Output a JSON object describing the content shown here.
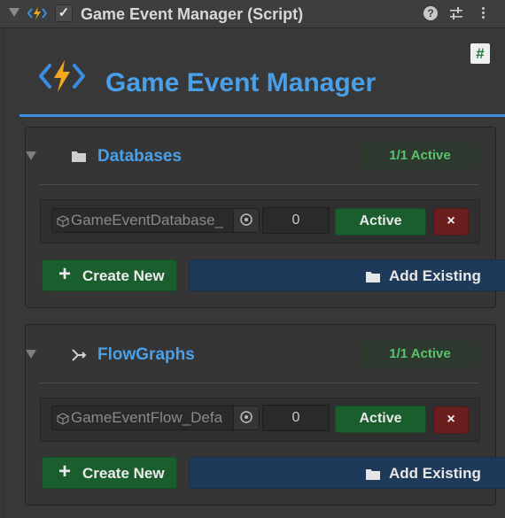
{
  "header": {
    "title": "Game Event Manager (Script)",
    "enabled": true,
    "help_icon": "help-icon",
    "presets_icon": "presets-icon",
    "more_icon": "kebab-menu-icon"
  },
  "script_badge": "#",
  "main_title": "Game Event Manager",
  "sections": [
    {
      "title": "Databases",
      "icon": "folder-icon",
      "status": "1/1 Active",
      "item": {
        "object_name": "GameEventDatabase_",
        "index": "0",
        "active_label": "Active",
        "remove_label": "×"
      },
      "create_label": "Create New",
      "add_label": "Add Existing"
    },
    {
      "title": "FlowGraphs",
      "icon": "flow-graph-icon",
      "status": "1/1 Active",
      "item": {
        "object_name": "GameEventFlow_Defa",
        "index": "0",
        "active_label": "Active",
        "remove_label": "×"
      },
      "create_label": "Create New",
      "add_label": "Add Existing"
    }
  ],
  "colors": {
    "accent_blue": "#4aa0e8",
    "active_green": "#1b5e2e",
    "status_green": "#58c46a",
    "remove_red": "#6a1e1e",
    "add_blue": "#1e3a5a"
  }
}
